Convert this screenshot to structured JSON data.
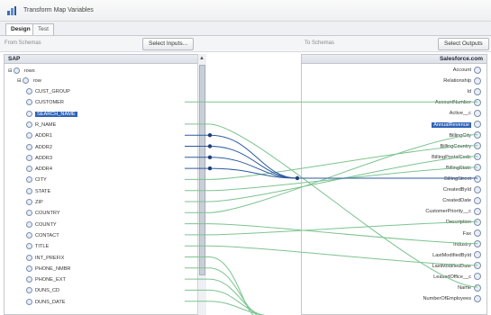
{
  "window": {
    "title": "Transform Map Variables"
  },
  "tabs": [
    {
      "label": "Design",
      "active": true
    },
    {
      "label": "Test",
      "active": false
    }
  ],
  "header": {
    "left_label": "From Schemas",
    "left_button": "Select Inputs...",
    "right_label": "To Schemas",
    "right_button": "Select Outputs"
  },
  "left_panel": {
    "title": "SAP",
    "tree": {
      "root": "rows",
      "child": "row"
    },
    "fields": [
      "CUST_GROUP",
      "CUSTOMER",
      "SEARCH_NAME",
      "R_NAME",
      "ADDR1",
      "ADDR2",
      "ADDR3",
      "ADDR4",
      "CITY",
      "STATE",
      "ZIP",
      "COUNTRY",
      "COUNTY",
      "CONTACT",
      "TITLE",
      "INT_PREFIX",
      "PHONE_NMBR",
      "PHONE_EXT",
      "DUNS_CD",
      "DUNS_DATE"
    ],
    "selected": "SEARCH_NAME"
  },
  "right_panel": {
    "title": "Salesforce.com",
    "fields": [
      "Account",
      "Relationship",
      "Id",
      "AccountNumber",
      "Active__c",
      "AnnualRevenue",
      "BillingCity",
      "BillingCountry",
      "BillingPostalCode",
      "BillingState",
      "BillingStreet",
      "CreatedById",
      "CreatedDate",
      "CustomerPriority__c",
      "Description",
      "Fax",
      "Industry",
      "LastModifiedById",
      "LastModifiedDate",
      "LeasedOffice__c",
      "Name",
      "NumberOfEmployees"
    ],
    "selected": "AnnualRevenue"
  },
  "colors": {
    "accent": "#2f63b8",
    "map_line": "#7cc48f",
    "map_line_active": "#2c5aa0"
  }
}
